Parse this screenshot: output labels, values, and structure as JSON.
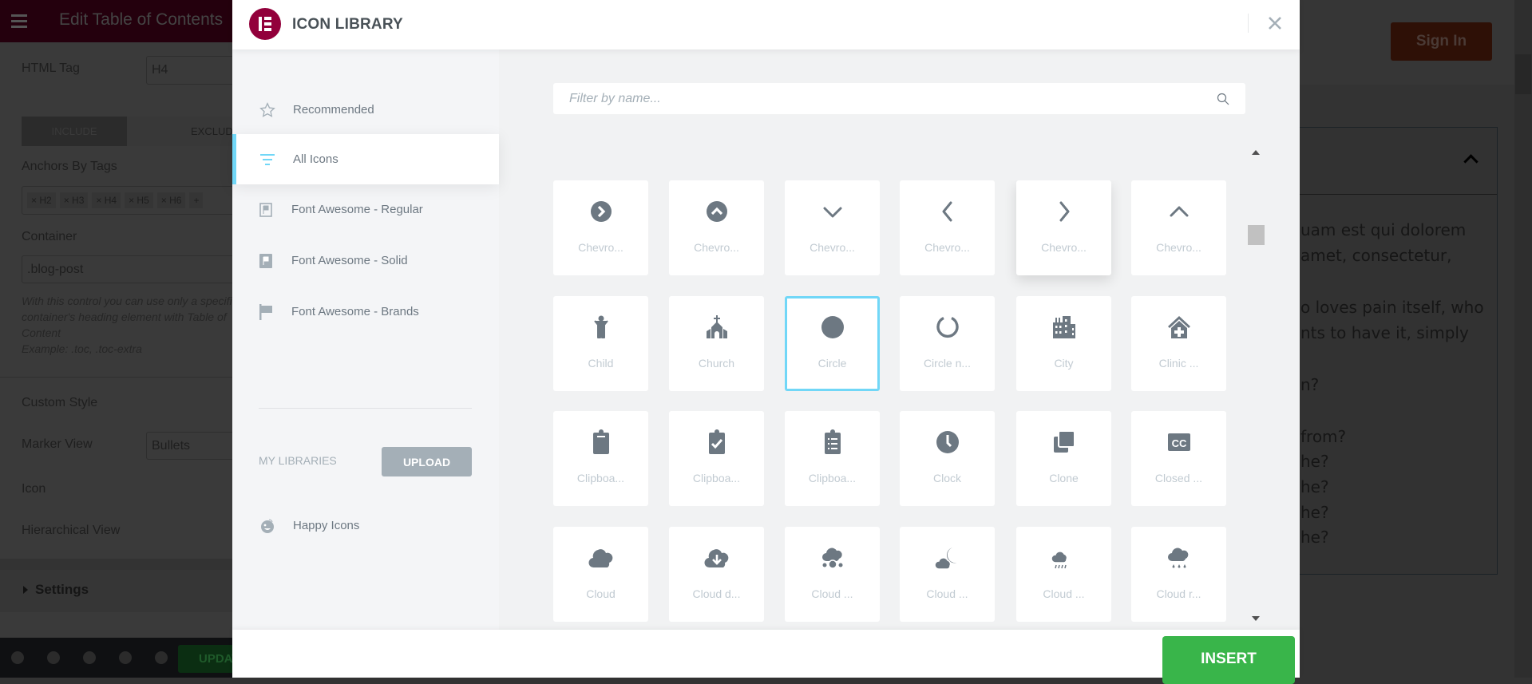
{
  "editor": {
    "title": "Edit Table of Contents",
    "html_tag_label": "HTML Tag",
    "html_tag_value": "H4",
    "tabs": [
      "INCLUDE",
      "EXCLUDE"
    ],
    "anchors_label": "Anchors By Tags",
    "anchor_tags": [
      "× H2",
      "× H3",
      "× H4",
      "× H5",
      "× H6"
    ],
    "add_tag": "+",
    "container_label": "Container",
    "container_value": ".blog-post",
    "help_lines": [
      "With this control you can use only a specific",
      "container's heading element with Table of",
      "Content",
      "Example: .toc, .toc-extra"
    ],
    "custom_style_label": "Custom Style",
    "marker_view_label": "Marker View",
    "marker_view_value": "Bullets",
    "icon_label": "Icon",
    "hierarchical_label": "Hierarchical View",
    "settings_section": "Settings",
    "update_label": "UPDATE"
  },
  "preview": {
    "sign_in": "Sign In",
    "lines": [
      "uam est qui dolorem",
      "amet, consectetur,",
      "o loves pain itself, who",
      "nts to have it, simply",
      "n?",
      "from?",
      "he?",
      "he?",
      "he?",
      "he?"
    ]
  },
  "modal": {
    "title": "ICON LIBRARY",
    "logo_text": "E",
    "sidebar": [
      {
        "label": "Recommended",
        "icon": "star-icon",
        "active": false
      },
      {
        "label": "All Icons",
        "icon": "filter-icon",
        "active": true
      },
      {
        "label": "Font Awesome - Regular",
        "icon": "flag-regular-icon",
        "active": false
      },
      {
        "label": "Font Awesome - Solid",
        "icon": "flag-solid-icon",
        "active": false
      },
      {
        "label": "Font Awesome - Brands",
        "icon": "flag-brands-icon",
        "active": false
      }
    ],
    "my_libraries": "MY LIBRARIES",
    "upload": "UPLOAD",
    "libraries": [
      {
        "label": "Happy Icons",
        "icon": "happy-icon"
      }
    ],
    "search_placeholder": "Filter by name...",
    "search_value": "",
    "selected_icon": "Circle",
    "icons": [
      {
        "label": "Chevro...",
        "icon": "chevron-circle-right"
      },
      {
        "label": "Chevro...",
        "icon": "chevron-circle-up"
      },
      {
        "label": "Chevro...",
        "icon": "chevron-down"
      },
      {
        "label": "Chevro...",
        "icon": "chevron-left"
      },
      {
        "label": "Chevro...",
        "icon": "chevron-right"
      },
      {
        "label": "Chevro...",
        "icon": "chevron-up"
      },
      {
        "label": "Child",
        "icon": "child"
      },
      {
        "label": "Church",
        "icon": "church"
      },
      {
        "label": "Circle",
        "icon": "circle"
      },
      {
        "label": "Circle n...",
        "icon": "circle-notch"
      },
      {
        "label": "City",
        "icon": "city"
      },
      {
        "label": "Clinic ...",
        "icon": "clinic-medical"
      },
      {
        "label": "Clipboa...",
        "icon": "clipboard"
      },
      {
        "label": "Clipboa...",
        "icon": "clipboard-check"
      },
      {
        "label": "Clipboa...",
        "icon": "clipboard-list"
      },
      {
        "label": "Clock",
        "icon": "clock"
      },
      {
        "label": "Clone",
        "icon": "clone"
      },
      {
        "label": "Closed ...",
        "icon": "closed-captioning"
      },
      {
        "label": "Cloud",
        "icon": "cloud"
      },
      {
        "label": "Cloud d...",
        "icon": "cloud-download"
      },
      {
        "label": "Cloud ...",
        "icon": "cloud-meatball"
      },
      {
        "label": "Cloud ...",
        "icon": "cloud-moon"
      },
      {
        "label": "Cloud ...",
        "icon": "cloud-moon-rain"
      },
      {
        "label": "Cloud r...",
        "icon": "cloud-rain"
      }
    ],
    "insert": "INSERT",
    "colors": {
      "accent": "#71d7f7",
      "insert": "#39b54a",
      "brand": "#92003b",
      "icon": "#6d7882"
    }
  }
}
